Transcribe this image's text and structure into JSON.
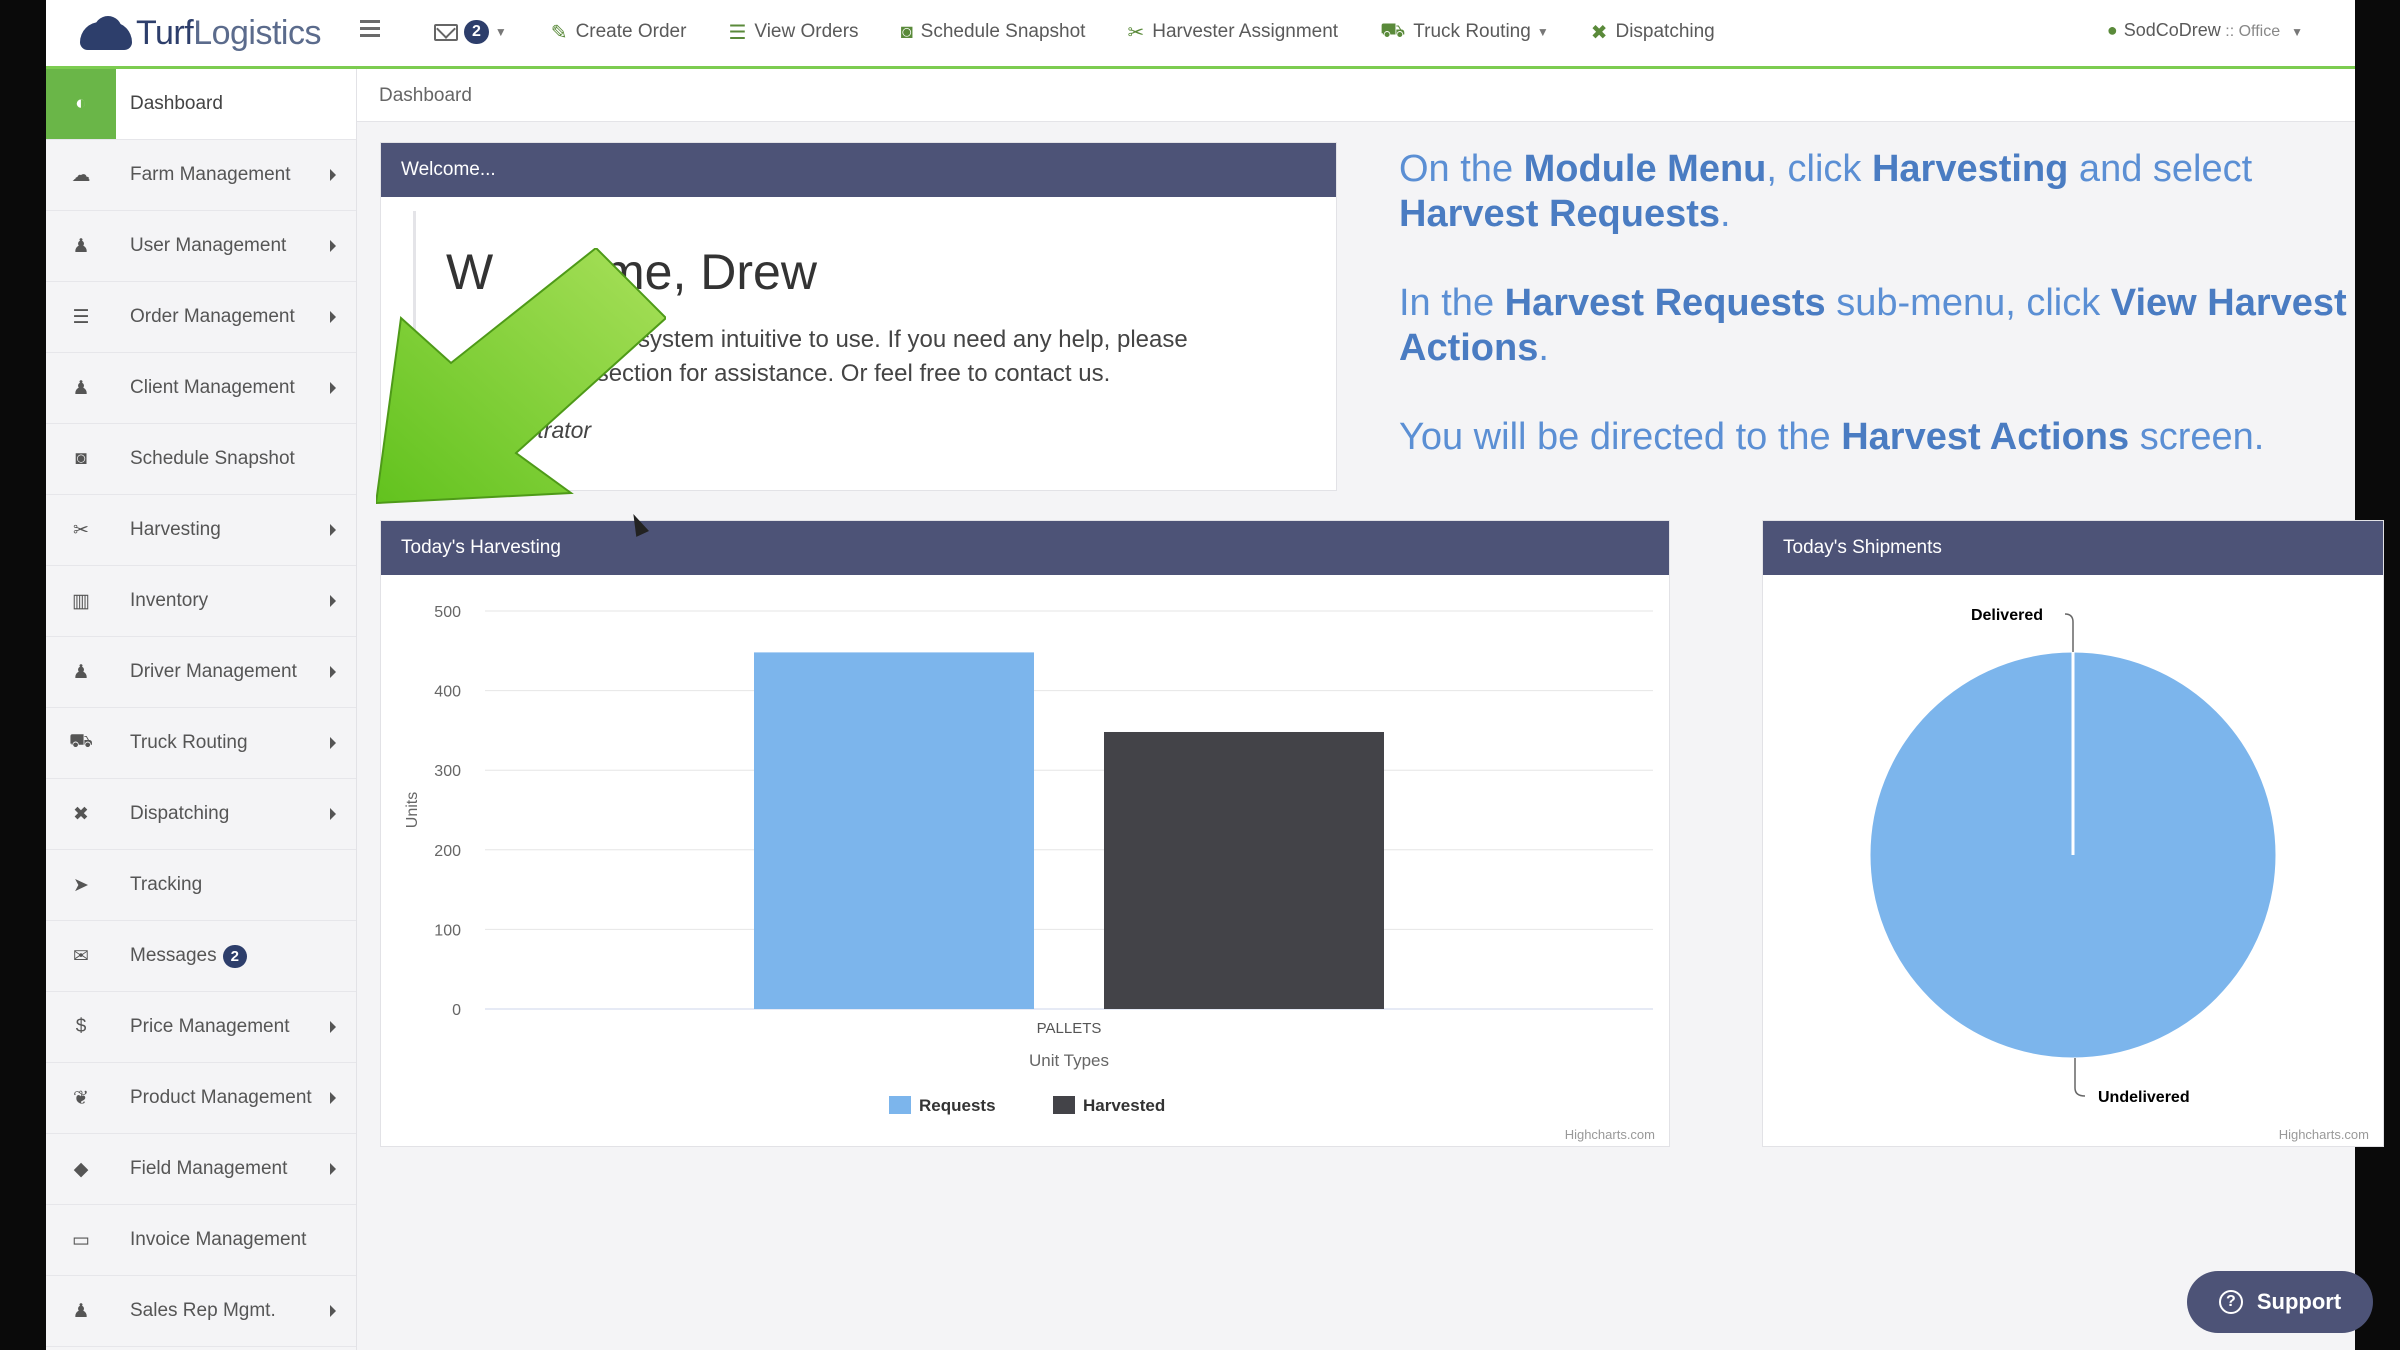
{
  "brand": {
    "turf": "Turf",
    "logistics": "Logistics"
  },
  "topnav": {
    "mail_count": "2",
    "items": [
      {
        "label": "Create Order",
        "icon": "edit-icon"
      },
      {
        "label": "View Orders",
        "icon": "list-icon"
      },
      {
        "label": "Schedule Snapshot",
        "icon": "camera-icon"
      },
      {
        "label": "Harvester Assignment",
        "icon": "scissors-icon"
      },
      {
        "label": "Truck Routing",
        "icon": "truck-icon"
      },
      {
        "label": "Dispatching",
        "icon": "dispatch-icon"
      }
    ],
    "user": "SodCoDrew",
    "user_sep": " :: ",
    "office": "Office"
  },
  "sidebar": {
    "items": [
      {
        "label": "Dashboard",
        "icon": "dashboard-icon",
        "arrow": false,
        "active": true
      },
      {
        "label": "Farm Management",
        "icon": "cloud-icon",
        "arrow": true
      },
      {
        "label": "User Management",
        "icon": "users-icon",
        "arrow": true
      },
      {
        "label": "Order Management",
        "icon": "list-icon",
        "arrow": true
      },
      {
        "label": "Client Management",
        "icon": "users-icon",
        "arrow": true
      },
      {
        "label": "Schedule Snapshot",
        "icon": "camera-icon",
        "arrow": false
      },
      {
        "label": "Harvesting",
        "icon": "scissors-icon",
        "arrow": true
      },
      {
        "label": "Inventory",
        "icon": "bar-chart-icon",
        "arrow": true
      },
      {
        "label": "Driver Management",
        "icon": "users-icon",
        "arrow": true
      },
      {
        "label": "Truck Routing",
        "icon": "truck-icon",
        "arrow": true
      },
      {
        "label": "Dispatching",
        "icon": "dispatch-icon",
        "arrow": true
      },
      {
        "label": "Tracking",
        "icon": "location-arrow-icon",
        "arrow": false
      },
      {
        "label": "Messages",
        "icon": "envelope-icon",
        "arrow": false,
        "badge": "2"
      },
      {
        "label": "Price Management",
        "icon": "dollar-icon",
        "arrow": true
      },
      {
        "label": "Product Management",
        "icon": "leaf-icon",
        "arrow": true
      },
      {
        "label": "Field Management",
        "icon": "tag-icon",
        "arrow": true
      },
      {
        "label": "Invoice Management",
        "icon": "folder-icon",
        "arrow": false
      },
      {
        "label": "Sales Rep Mgmt.",
        "icon": "users-icon",
        "arrow": true
      }
    ]
  },
  "breadcrumb": "Dashboard",
  "welcome": {
    "header": "Welcome...",
    "title_start": "W",
    "title_end": "ome, Drew",
    "text_start": "",
    "text_line1": "ind our system intuitive to use. If you need any help, please",
    "text_line2": "elp section for assistance. Or feel free to contact us.",
    "sign": "nistrator"
  },
  "instructions": [
    [
      {
        "t": "On the "
      },
      {
        "t": "Module Menu",
        "b": true
      },
      {
        "t": ", click "
      },
      {
        "t": "Harvesting",
        "b": true
      },
      {
        "t": " and select "
      },
      {
        "t": "Harvest Requests",
        "b": true
      },
      {
        "t": "."
      }
    ],
    [
      {
        "t": "In the "
      },
      {
        "t": "Harvest Requests",
        "b": true
      },
      {
        "t": " sub-menu, click "
      },
      {
        "t": "View Harvest Actions",
        "b": true
      },
      {
        "t": "."
      }
    ],
    [
      {
        "t": "You will be directed to the "
      },
      {
        "t": "Harvest Actions",
        "b": true
      },
      {
        "t": " screen."
      }
    ]
  ],
  "harvest_panel": {
    "header": "Today's Harvesting",
    "credit": "Highcharts.com"
  },
  "shipments_panel": {
    "header": "Today's Shipments",
    "credit": "Highcharts.com"
  },
  "support": "Support",
  "colors": {
    "requests": "#7cb5ec",
    "harvested": "#434348",
    "header": "#4d5377",
    "accent": "#6ab648"
  },
  "chart_data": [
    {
      "type": "bar",
      "categories": [
        "PALLETS"
      ],
      "series": [
        {
          "name": "Requests",
          "values": [
            448
          ]
        },
        {
          "name": "Harvested",
          "values": [
            348
          ]
        }
      ],
      "xlabel": "Unit Types",
      "ylabel": "Units",
      "ylim": [
        0,
        500
      ],
      "yticks": [
        0,
        100,
        200,
        300,
        400,
        500
      ],
      "grid": true,
      "legend": "bottom-center"
    },
    {
      "type": "pie",
      "slices": [
        {
          "name": "Delivered",
          "value": 0
        },
        {
          "name": "Undelivered",
          "value": 100
        }
      ]
    }
  ]
}
